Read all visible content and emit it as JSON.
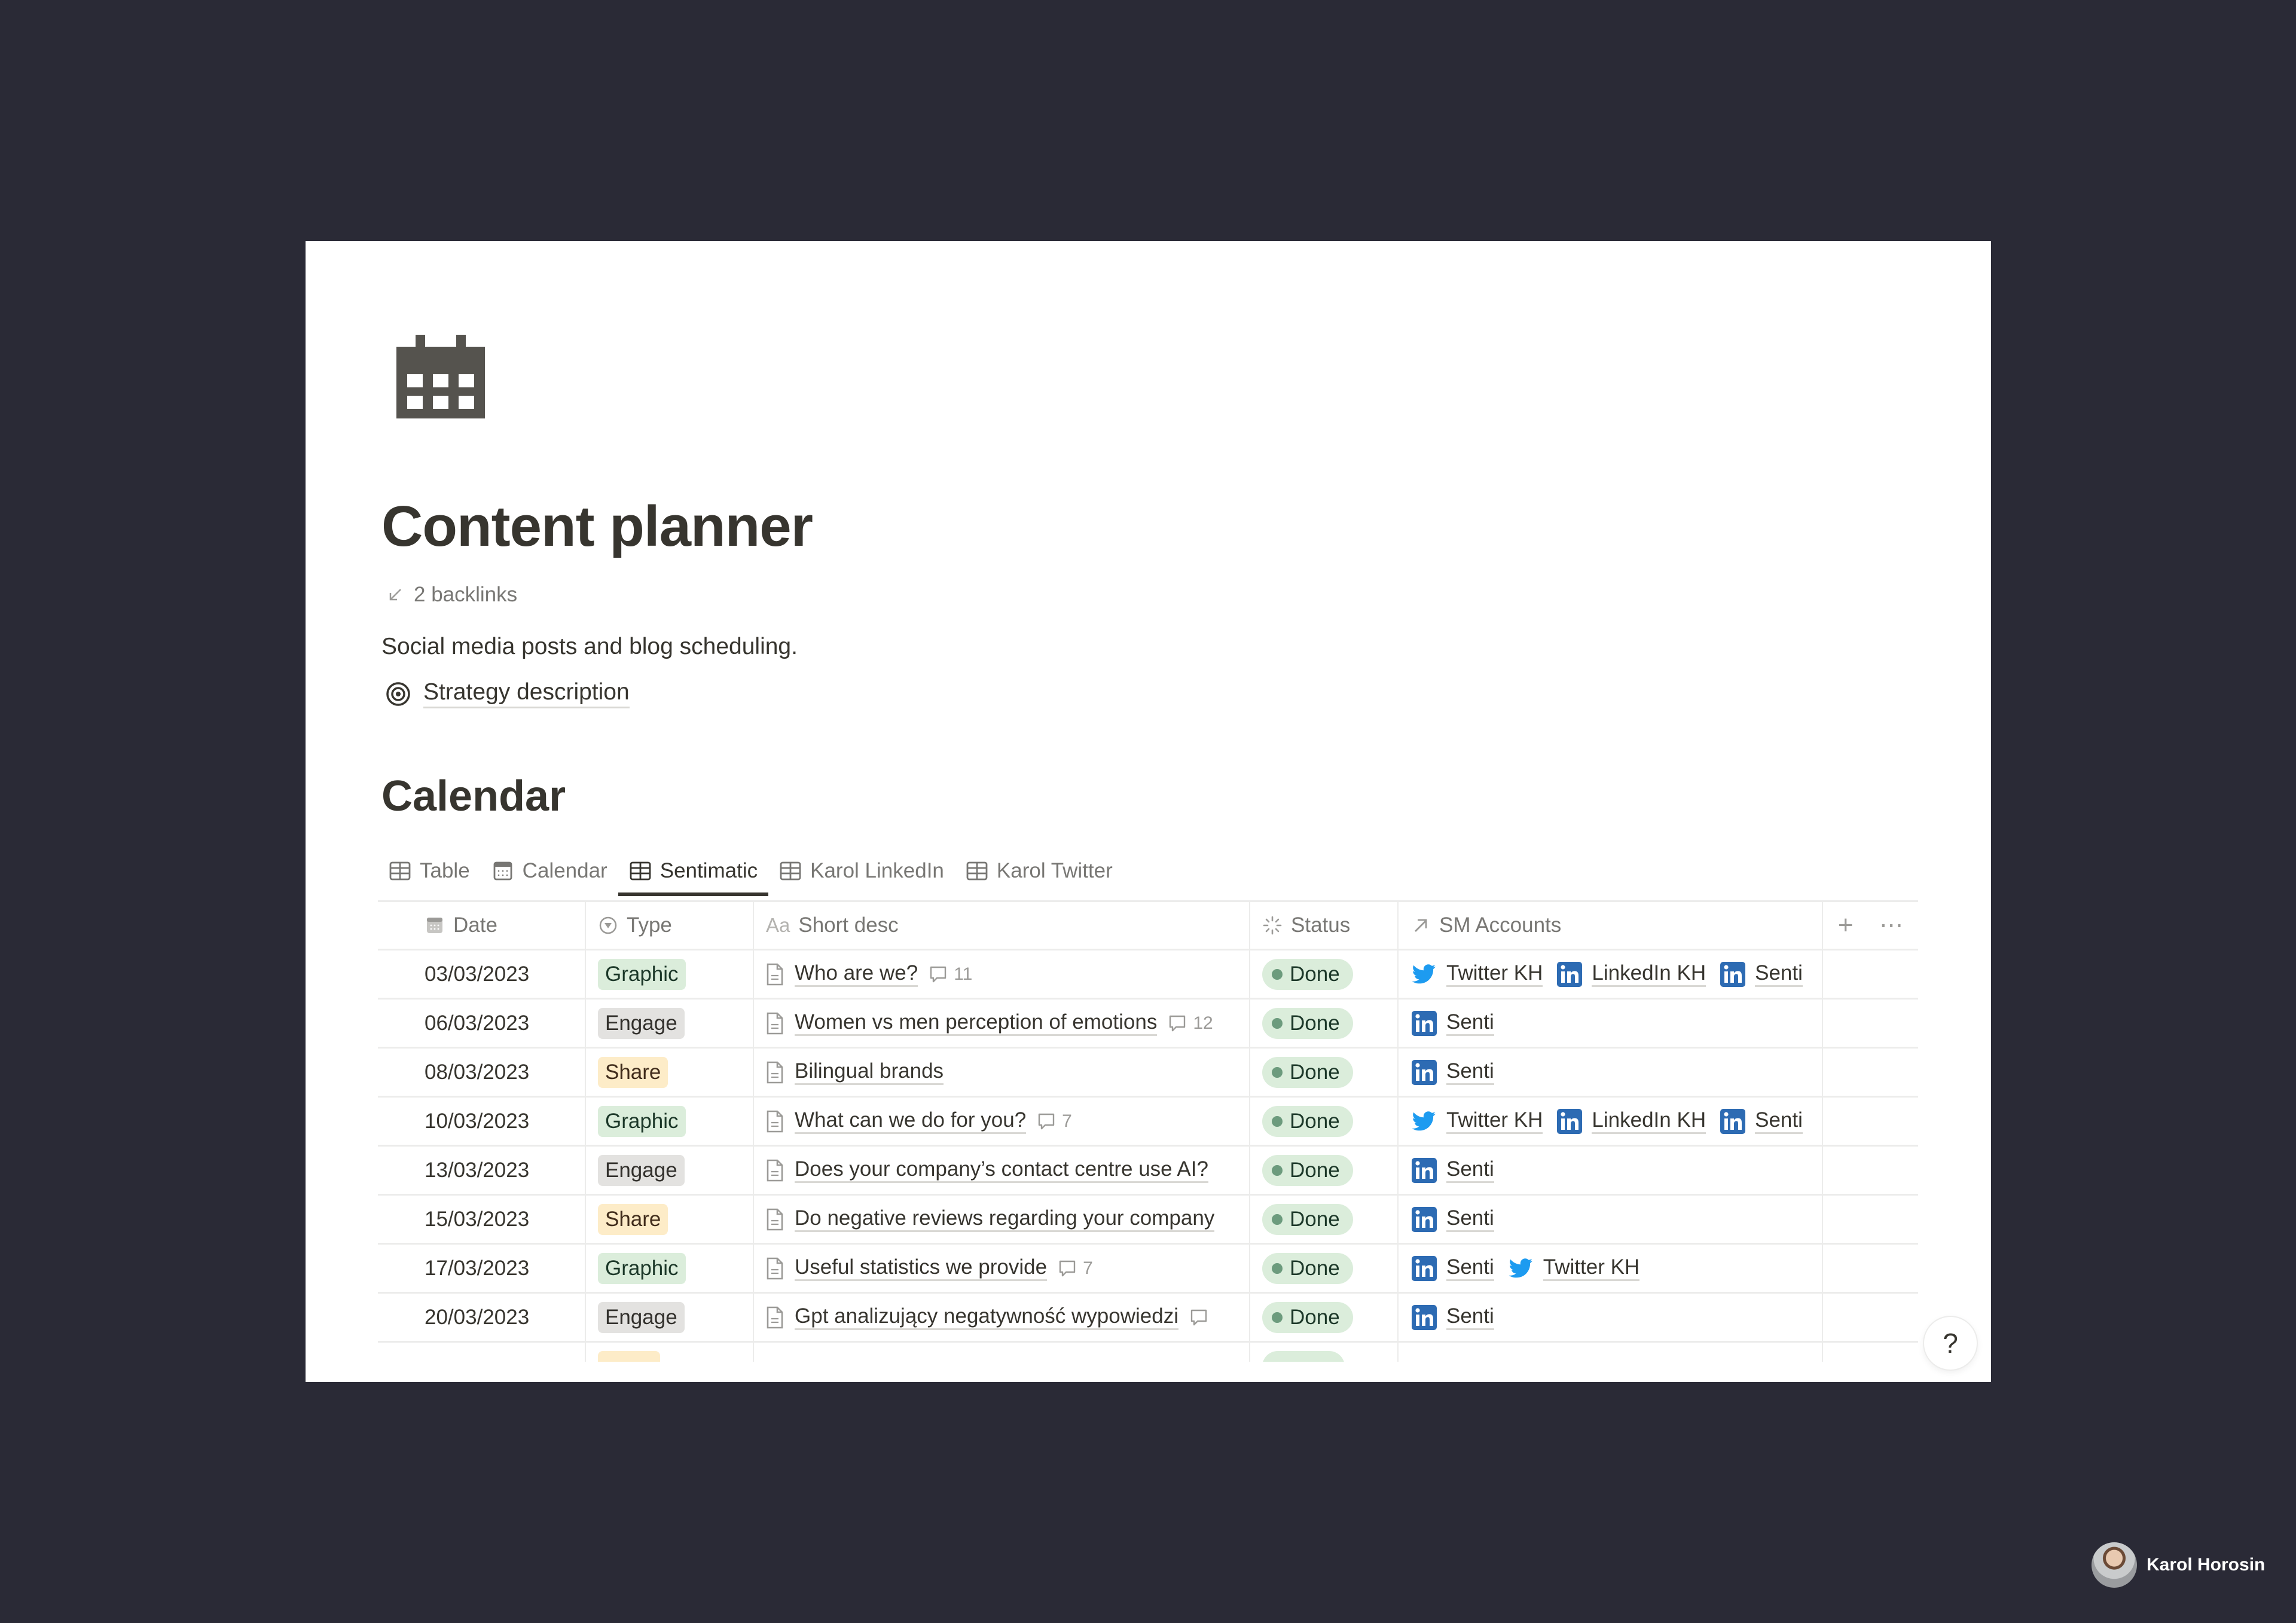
{
  "page": {
    "icon": "calendar-icon",
    "title": "Content planner",
    "backlinks": "2 backlinks",
    "description": "Social media posts and blog scheduling.",
    "strategy_link": "Strategy description"
  },
  "database": {
    "heading": "Calendar",
    "tabs": [
      {
        "label": "Table",
        "icon": "table-icon",
        "active": false
      },
      {
        "label": "Calendar",
        "icon": "calendar-view-icon",
        "active": false
      },
      {
        "label": "Sentimatic",
        "icon": "table-icon",
        "active": true
      },
      {
        "label": "Karol LinkedIn",
        "icon": "table-icon",
        "active": false
      },
      {
        "label": "Karol Twitter",
        "icon": "table-icon",
        "active": false
      }
    ],
    "columns": [
      {
        "label": "Date",
        "icon": "date-property-icon"
      },
      {
        "label": "Type",
        "icon": "select-property-icon"
      },
      {
        "label": "Short desc",
        "icon": "title-property-icon"
      },
      {
        "label": "Status",
        "icon": "status-property-icon"
      },
      {
        "label": "SM Accounts",
        "icon": "relation-property-icon"
      }
    ],
    "add_column_label": "+",
    "more_label": "⋯",
    "type_colors": {
      "Graphic": {
        "bg": "#dbeddb",
        "fg": "#1c3829"
      },
      "Engage": {
        "bg": "#e3e2e0",
        "fg": "#32302c"
      },
      "Share": {
        "bg": "#fdecc8",
        "fg": "#402c1b"
      }
    },
    "rows": [
      {
        "date": "03/03/2023",
        "type": "Graphic",
        "desc": "Who are we?",
        "comments": "11",
        "status": "Done",
        "accounts": [
          {
            "name": "Twitter KH",
            "kind": "twitter"
          },
          {
            "name": "LinkedIn KH",
            "kind": "linkedin"
          },
          {
            "name": "Senti",
            "kind": "linkedin"
          }
        ]
      },
      {
        "date": "06/03/2023",
        "type": "Engage",
        "desc": "Women vs men perception of emotions",
        "comments": "12",
        "status": "Done",
        "accounts": [
          {
            "name": "Senti",
            "kind": "linkedin"
          }
        ]
      },
      {
        "date": "08/03/2023",
        "type": "Share",
        "desc": "Bilingual brands",
        "comments": "",
        "status": "Done",
        "accounts": [
          {
            "name": "Senti",
            "kind": "linkedin"
          }
        ]
      },
      {
        "date": "10/03/2023",
        "type": "Graphic",
        "desc": "What can we do for you?",
        "comments": "7",
        "status": "Done",
        "accounts": [
          {
            "name": "Twitter KH",
            "kind": "twitter"
          },
          {
            "name": "LinkedIn KH",
            "kind": "linkedin"
          },
          {
            "name": "Senti",
            "kind": "linkedin"
          }
        ]
      },
      {
        "date": "13/03/2023",
        "type": "Engage",
        "desc": "Does your company’s contact centre use AI?",
        "comments": "",
        "status": "Done",
        "accounts": [
          {
            "name": "Senti",
            "kind": "linkedin"
          }
        ]
      },
      {
        "date": "15/03/2023",
        "type": "Share",
        "desc": "Do negative reviews regarding your company",
        "comments": "",
        "status": "Done",
        "accounts": [
          {
            "name": "Senti",
            "kind": "linkedin"
          }
        ]
      },
      {
        "date": "17/03/2023",
        "type": "Graphic",
        "desc": "Useful statistics we provide",
        "comments": "7",
        "status": "Done",
        "accounts": [
          {
            "name": "Senti",
            "kind": "linkedin"
          },
          {
            "name": "Twitter KH",
            "kind": "twitter"
          }
        ]
      },
      {
        "date": "20/03/2023",
        "type": "Engage",
        "desc": "Gpt analizujący negatywność wypowiedzi",
        "comments": "",
        "has_comment_icon": true,
        "status": "Done",
        "accounts": [
          {
            "name": "Senti",
            "kind": "linkedin"
          }
        ]
      }
    ]
  },
  "help_button": "?",
  "presenter": {
    "name": "Karol Horosin"
  }
}
